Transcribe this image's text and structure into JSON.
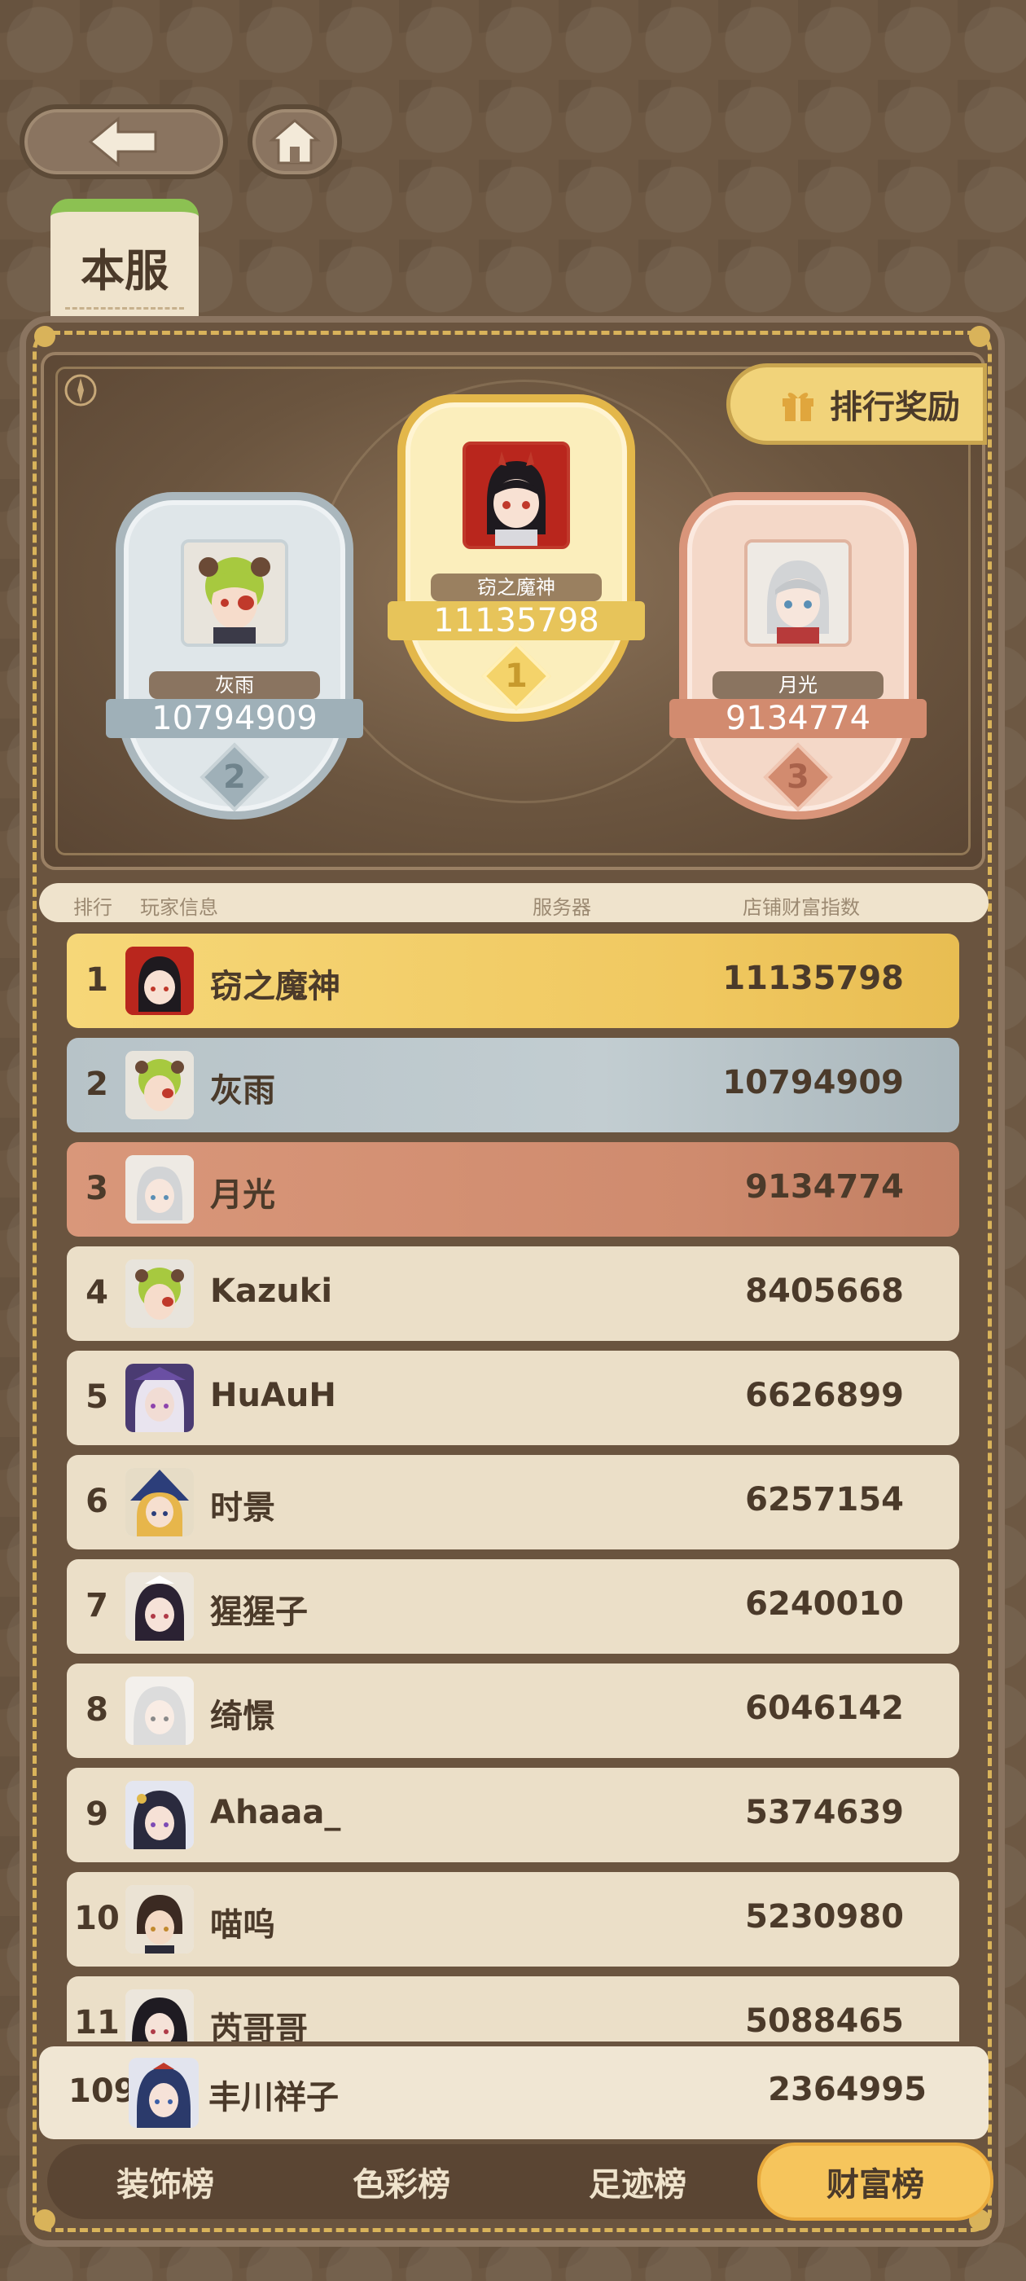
{
  "nav": {
    "back_icon": "back-arrow-icon",
    "home_icon": "home-icon"
  },
  "server_tab": "本服",
  "reward_button": {
    "label": "排行奖励",
    "icon": "gift-icon"
  },
  "podium": [
    {
      "rank": "2",
      "name": "灰雨",
      "score": "10794909"
    },
    {
      "rank": "1",
      "name": "窃之魔神",
      "score": "11135798"
    },
    {
      "rank": "3",
      "name": "月光",
      "score": "9134774"
    }
  ],
  "headers": {
    "rank": "排行",
    "player": "玩家信息",
    "server": "服务器",
    "score": "店铺财富指数"
  },
  "rows": [
    {
      "rank": "1",
      "name": "窃之魔神",
      "score": "11135798"
    },
    {
      "rank": "2",
      "name": "灰雨",
      "score": "10794909"
    },
    {
      "rank": "3",
      "name": "月光",
      "score": "9134774"
    },
    {
      "rank": "4",
      "name": "Kazuki",
      "score": "8405668"
    },
    {
      "rank": "5",
      "name": "HuAuH",
      "score": "6626899"
    },
    {
      "rank": "6",
      "name": "时景",
      "score": "6257154"
    },
    {
      "rank": "7",
      "name": "猩猩子",
      "score": "6240010"
    },
    {
      "rank": "8",
      "name": "绮憬",
      "score": "6046142"
    },
    {
      "rank": "9",
      "name": "Ahaaa_",
      "score": "5374639"
    },
    {
      "rank": "10",
      "name": "喵呜",
      "score": "5230980"
    },
    {
      "rank": "11",
      "name": "芮哥哥",
      "score": "5088465"
    }
  ],
  "self": {
    "rank": "109",
    "name": "丰川祥子",
    "score": "2364995"
  },
  "bottom_tabs": [
    "装饰榜",
    "色彩榜",
    "足迹榜",
    "财富榜"
  ],
  "active_tab": "财富榜",
  "colors": {
    "gold": "#f1d37a",
    "silver": "#b7c3c8",
    "bronze": "#cf8b6e",
    "panel": "#6a543f",
    "active_tab": "#f6c55c"
  }
}
